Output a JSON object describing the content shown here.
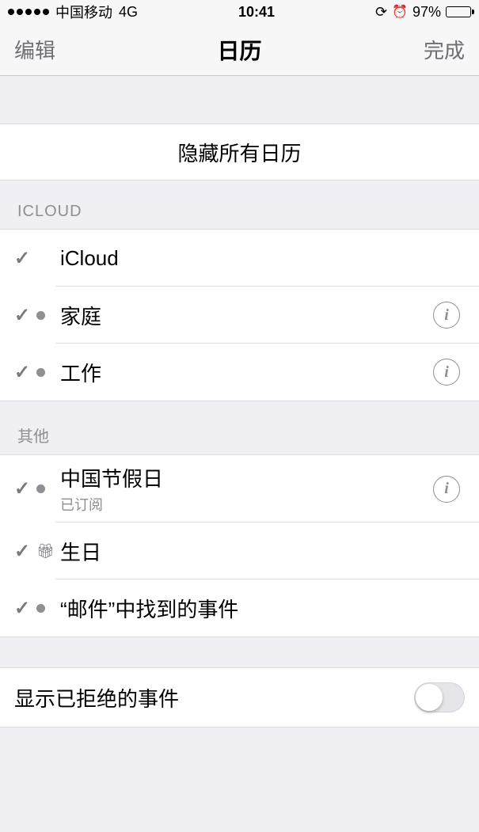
{
  "status": {
    "carrier": "中国移动",
    "network": "4G",
    "time": "10:41",
    "battery_pct": "97%"
  },
  "nav": {
    "left": "编辑",
    "title": "日历",
    "right": "完成"
  },
  "hide_all": "隐藏所有日历",
  "sections": {
    "icloud": {
      "header": "ICLOUD",
      "items": [
        {
          "label": "iCloud"
        },
        {
          "label": "家庭"
        },
        {
          "label": "工作"
        }
      ]
    },
    "other": {
      "header": "其他",
      "items": [
        {
          "label": "中国节假日",
          "sub": "已订阅"
        },
        {
          "label": "生日"
        },
        {
          "label": "“邮件”中找到的事件"
        }
      ]
    }
  },
  "toggle_row": {
    "label": "显示已拒绝的事件",
    "on": false
  }
}
